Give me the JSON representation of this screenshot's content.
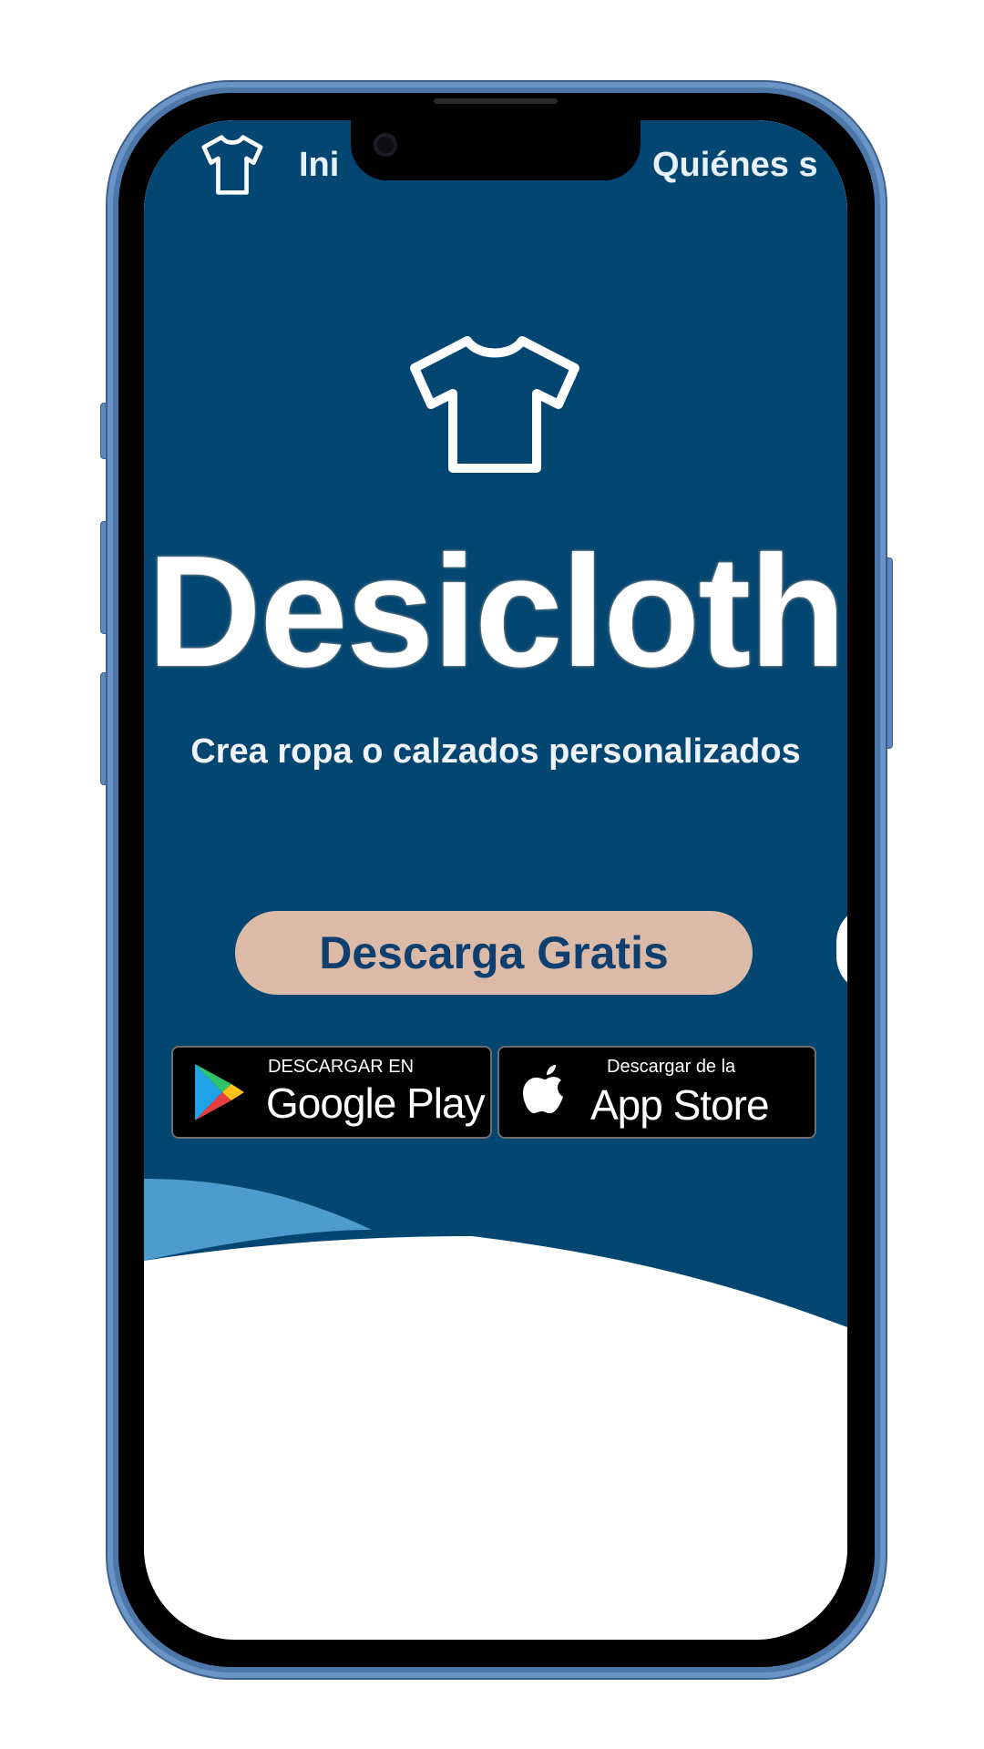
{
  "colors": {
    "hero_background": "#024671",
    "wave_light": "#4e9ccb",
    "cta_background": "#dcbaa8",
    "cta_text": "#0f3f6e",
    "phone_frame": "#4c77a8"
  },
  "nav": {
    "logo_icon": "tshirt-icon",
    "links": [
      "Ini",
      "Quiénes s"
    ]
  },
  "hero": {
    "logo_icon": "tshirt-icon",
    "title": "Desicloth",
    "tagline": "Crea ropa o calzados personalizados",
    "cta_label": "Descarga Gratis"
  },
  "stores": {
    "google_play": {
      "small": "DESCARGAR EN",
      "big": "Google Play",
      "icon": "google-play-icon"
    },
    "app_store": {
      "small": "Descargar de la",
      "big": "App Store",
      "icon": "apple-icon"
    }
  }
}
